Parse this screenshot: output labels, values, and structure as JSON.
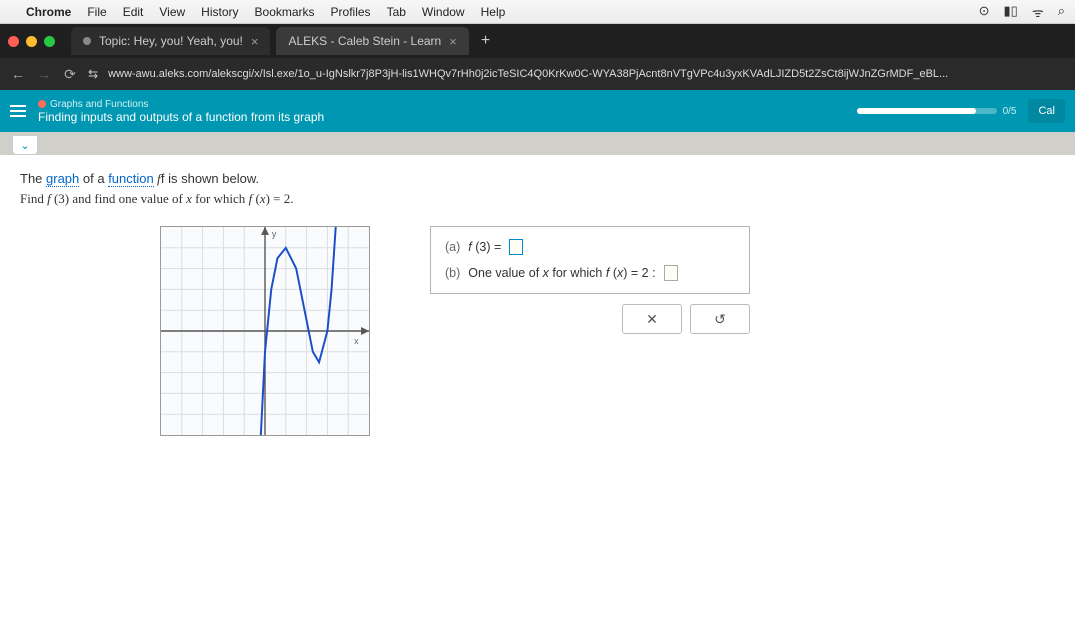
{
  "mac_menu": {
    "app": "Chrome",
    "items": [
      "File",
      "Edit",
      "View",
      "History",
      "Bookmarks",
      "Profiles",
      "Tab",
      "Window",
      "Help"
    ]
  },
  "browser": {
    "tabs": [
      {
        "title": "Topic: Hey, you! Yeah, you!",
        "active": false
      },
      {
        "title": "ALEKS - Caleb Stein - Learn",
        "active": true
      }
    ],
    "url": "www-awu.aleks.com/alekscgi/x/Isl.exe/1o_u-IgNslkr7j8P3jH-lis1WHQv7rHh0j2icTeSIC4Q0KrKw0C-WYA38PjAcnt8nVTgVPc4u3yxKVAdLJIZD5t2ZsCt8ijWJnZGrMDF_eBL..."
  },
  "aleks": {
    "category": "Graphs and Functions",
    "subtitle": "Finding inputs and outputs of a function from its graph",
    "progress_label": "0/5",
    "calc": "Cal"
  },
  "problem": {
    "line1a": "The ",
    "link1": "graph",
    "line1b": " of a ",
    "link2": "function",
    "line1c": " f is shown below.",
    "line2a": "Find f (3) and find one value of x for which f (x) = 2."
  },
  "answers": {
    "a_label": "(a)",
    "a_expr": "f (3) = ",
    "b_label": "(b)",
    "b_expr": "One value of x for which f (x) = 2 : "
  },
  "buttons": {
    "clear": "✕",
    "reset": "↺"
  },
  "chart_data": {
    "type": "line",
    "title": "",
    "xlabel": "x",
    "ylabel": "y",
    "xlim": [
      -5,
      5
    ],
    "ylim": [
      -5,
      5
    ],
    "series": [
      {
        "name": "f",
        "points": [
          [
            -0.2,
            -5
          ],
          [
            0,
            -1
          ],
          [
            0.3,
            2
          ],
          [
            0.6,
            3.5
          ],
          [
            1,
            4
          ],
          [
            1.5,
            3
          ],
          [
            2,
            0.5
          ],
          [
            2.3,
            -1
          ],
          [
            2.6,
            -1.5
          ],
          [
            3,
            0
          ],
          [
            3.2,
            2
          ],
          [
            3.4,
            5
          ]
        ]
      }
    ]
  }
}
